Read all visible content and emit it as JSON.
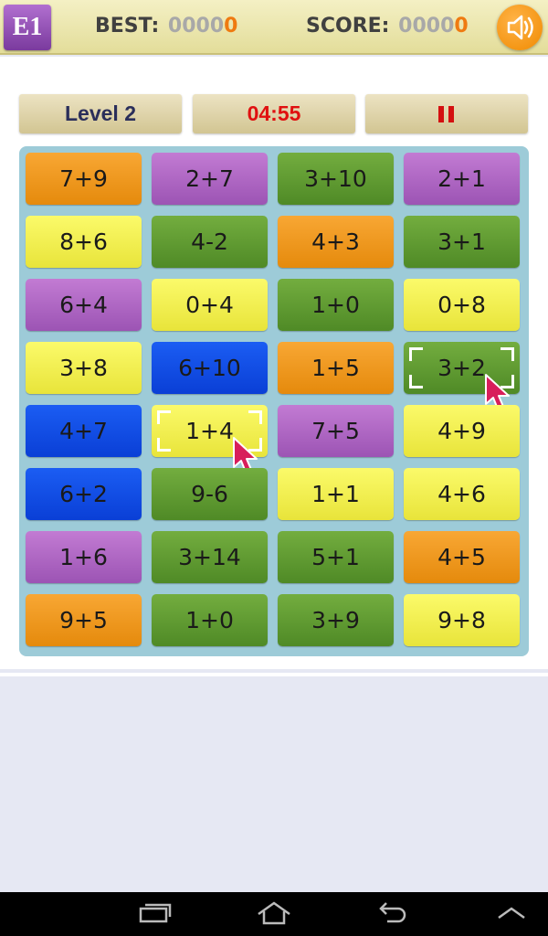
{
  "header": {
    "logo_text": "E1",
    "best_label": "BEST:",
    "best_value_dim": "0000",
    "best_value_last": "0",
    "score_label": "SCORE:",
    "score_value_dim": "0000",
    "score_value_last": "0",
    "sound_icon": "speaker-icon"
  },
  "controls": {
    "level": "Level 2",
    "timer": "04:55",
    "pause_icon": "pause-icon"
  },
  "colors": {
    "orange": "#f09a20",
    "purple": "#b068c6",
    "green": "#5f9a30",
    "yellow": "#f2f050",
    "blue": "#1050e8",
    "timer_red": "#e01010",
    "cursor": "#d81e5b"
  },
  "tiles": [
    [
      {
        "text": "7+9",
        "color": "orange"
      },
      {
        "text": "2+7",
        "color": "purple"
      },
      {
        "text": "3+10",
        "color": "green"
      },
      {
        "text": "2+1",
        "color": "purple"
      }
    ],
    [
      {
        "text": "8+6",
        "color": "yellow"
      },
      {
        "text": "4-2",
        "color": "green"
      },
      {
        "text": "4+3",
        "color": "orange"
      },
      {
        "text": "3+1",
        "color": "green"
      }
    ],
    [
      {
        "text": "6+4",
        "color": "purple"
      },
      {
        "text": "0+4",
        "color": "yellow"
      },
      {
        "text": "1+0",
        "color": "green"
      },
      {
        "text": "0+8",
        "color": "yellow"
      }
    ],
    [
      {
        "text": "3+8",
        "color": "yellow"
      },
      {
        "text": "6+10",
        "color": "blue"
      },
      {
        "text": "1+5",
        "color": "orange"
      },
      {
        "text": "3+2",
        "color": "green",
        "selected": true
      }
    ],
    [
      {
        "text": "4+7",
        "color": "blue"
      },
      {
        "text": "1+4",
        "color": "yellow",
        "selected": true
      },
      {
        "text": "7+5",
        "color": "purple"
      },
      {
        "text": "4+9",
        "color": "yellow"
      }
    ],
    [
      {
        "text": "6+2",
        "color": "blue"
      },
      {
        "text": "9-6",
        "color": "green"
      },
      {
        "text": "1+1",
        "color": "yellow"
      },
      {
        "text": "4+6",
        "color": "yellow"
      }
    ],
    [
      {
        "text": "1+6",
        "color": "purple"
      },
      {
        "text": "3+14",
        "color": "green"
      },
      {
        "text": "5+1",
        "color": "green"
      },
      {
        "text": "4+5",
        "color": "orange"
      }
    ],
    [
      {
        "text": "9+5",
        "color": "orange"
      },
      {
        "text": "1+0",
        "color": "green"
      },
      {
        "text": "3+9",
        "color": "green"
      },
      {
        "text": "9+8",
        "color": "yellow"
      }
    ]
  ],
  "navbar": {
    "recent_icon": "recent-apps-icon",
    "home_icon": "home-icon",
    "back_icon": "back-icon",
    "menu_icon": "chevron-up-icon"
  }
}
